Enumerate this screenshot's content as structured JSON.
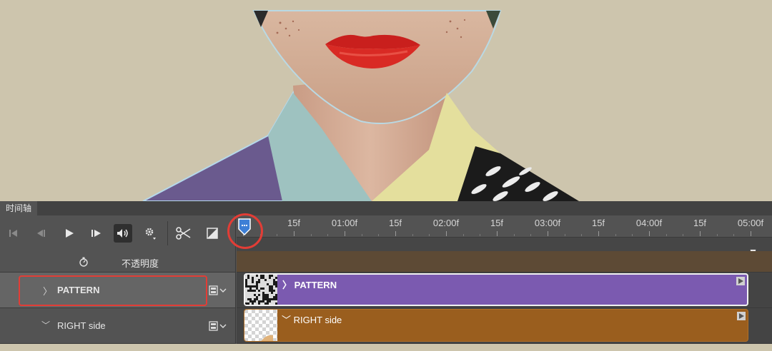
{
  "panel": {
    "tab_label": "时间轴"
  },
  "controls": [
    {
      "name": "go-to-first-frame-icon"
    },
    {
      "name": "previous-frame-icon"
    },
    {
      "name": "play-icon"
    },
    {
      "name": "next-frame-icon"
    },
    {
      "name": "audio-icon"
    },
    {
      "name": "settings-gear-icon"
    },
    {
      "name": "split-at-playhead-icon"
    },
    {
      "name": "transition-icon"
    }
  ],
  "ruler": {
    "labels": [
      "15f",
      "01:00f",
      "15f",
      "02:00f",
      "15f",
      "03:00f",
      "15f",
      "04:00f",
      "15f",
      "05:00f"
    ]
  },
  "tracks": {
    "opacity_label": "不透明度",
    "pattern": {
      "layer_name": "PATTERN",
      "clip_label": "PATTERN",
      "color": "#7b5ab0"
    },
    "right_side": {
      "layer_name": "RIGHT side",
      "clip_label": "RIGHT side",
      "color": "#9a5e1e"
    }
  },
  "colors": {
    "annotation": "#e23d36",
    "work_area": "#d5882b"
  }
}
